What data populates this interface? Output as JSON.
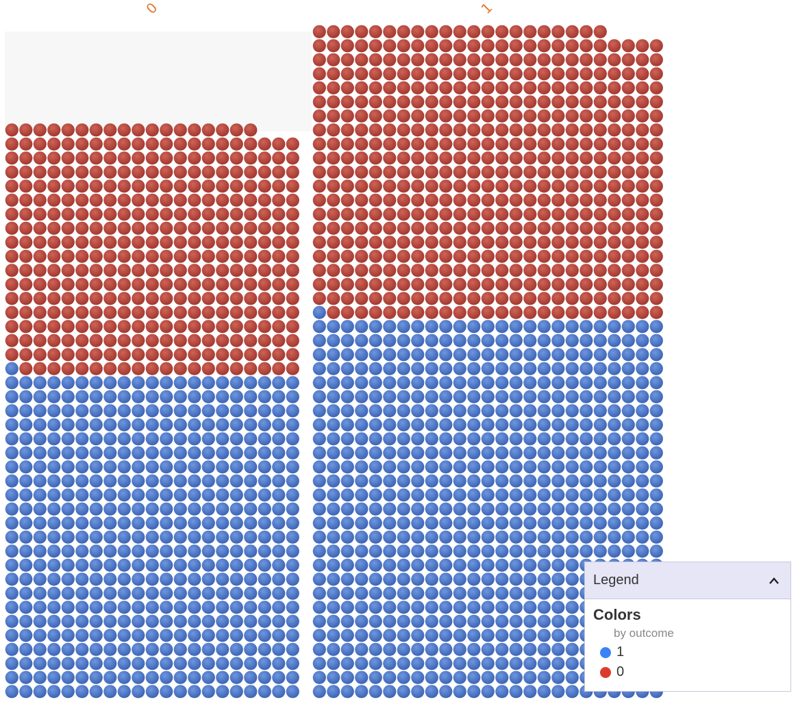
{
  "chart_data": {
    "type": "unit",
    "facets": [
      {
        "label": "0",
        "counts": {
          "1": 484,
          "0": 374
        }
      },
      {
        "label": "1",
        "counts": {
          "1": 676,
          "0": 520
        }
      }
    ],
    "colors": {
      "1": "#4a76c9",
      "0": "#b5443a"
    }
  },
  "legend": {
    "header": "Legend",
    "section_title": "Colors",
    "subtitle": "by outcome",
    "items": [
      {
        "label": "1",
        "color": "#3b82f6"
      },
      {
        "label": "0",
        "color": "#dc3b2f"
      }
    ]
  }
}
